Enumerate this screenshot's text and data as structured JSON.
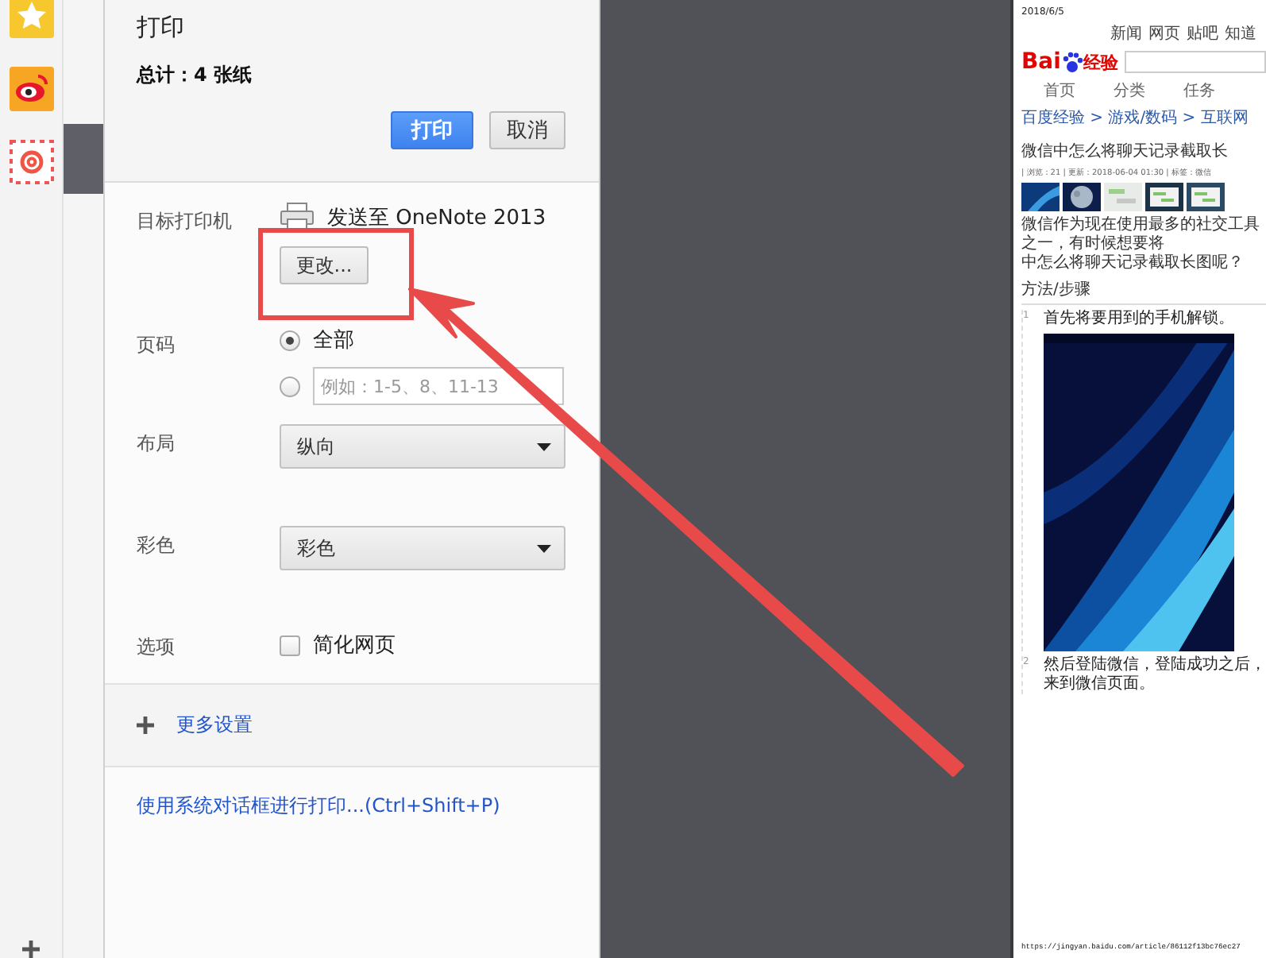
{
  "dialog": {
    "title": "打印",
    "total": "总计：4 张纸",
    "buttons": [
      {
        "label": "打印",
        "kind": "primary"
      },
      {
        "label": "取消",
        "kind": "secondary"
      }
    ],
    "settings": [
      {
        "kind": "printer",
        "label": "目标打印机",
        "value": "发送至 OneNote 2013",
        "button": "更改..."
      },
      {
        "kind": "pages",
        "label": "页码",
        "options": [
          {
            "label": "全部",
            "selected": true
          },
          {
            "placeholder": "例如：1-5、8、11-13",
            "selected": false
          }
        ]
      },
      {
        "kind": "select",
        "label": "布局",
        "value": "纵向"
      },
      {
        "kind": "select",
        "label": "彩色",
        "value": "彩色"
      },
      {
        "kind": "checkbox",
        "label": "选项",
        "option": "简化网页",
        "checked": false
      }
    ],
    "more_settings": "更多设置",
    "system_dialog_link": "使用系统对话框进行打印...(Ctrl+Shift+P)"
  },
  "preview": {
    "date": "2018/6/5",
    "logo_left": "Bai",
    "logo_right": "经验",
    "nav": [
      "新闻",
      "网页",
      "贴吧",
      "知道"
    ],
    "tabs": [
      "首页",
      "分类",
      "任务"
    ],
    "breadcrumb": "百度经验 > 游戏/数码 > 互联网",
    "title": "微信中怎么将聊天记录截取长",
    "meta": "| 浏览：21 | 更新：2018-06-04 01:30 | 标签：微信",
    "intro": [
      "微信作为现在使用最多的社交工具之一，有时候想要将",
      "中怎么将聊天记录截取长图呢？"
    ],
    "section": "方法/步骤",
    "steps": [
      {
        "number": "1",
        "text": "首先将要用到的手机解锁。",
        "kind": "picture"
      },
      {
        "number": "2",
        "text": "然后登陆微信，登陆成功之后，来到微信页面。",
        "kind": "text"
      }
    ],
    "url": "https://jingyan.baidu.com/article/86112f13bc76ec27"
  }
}
